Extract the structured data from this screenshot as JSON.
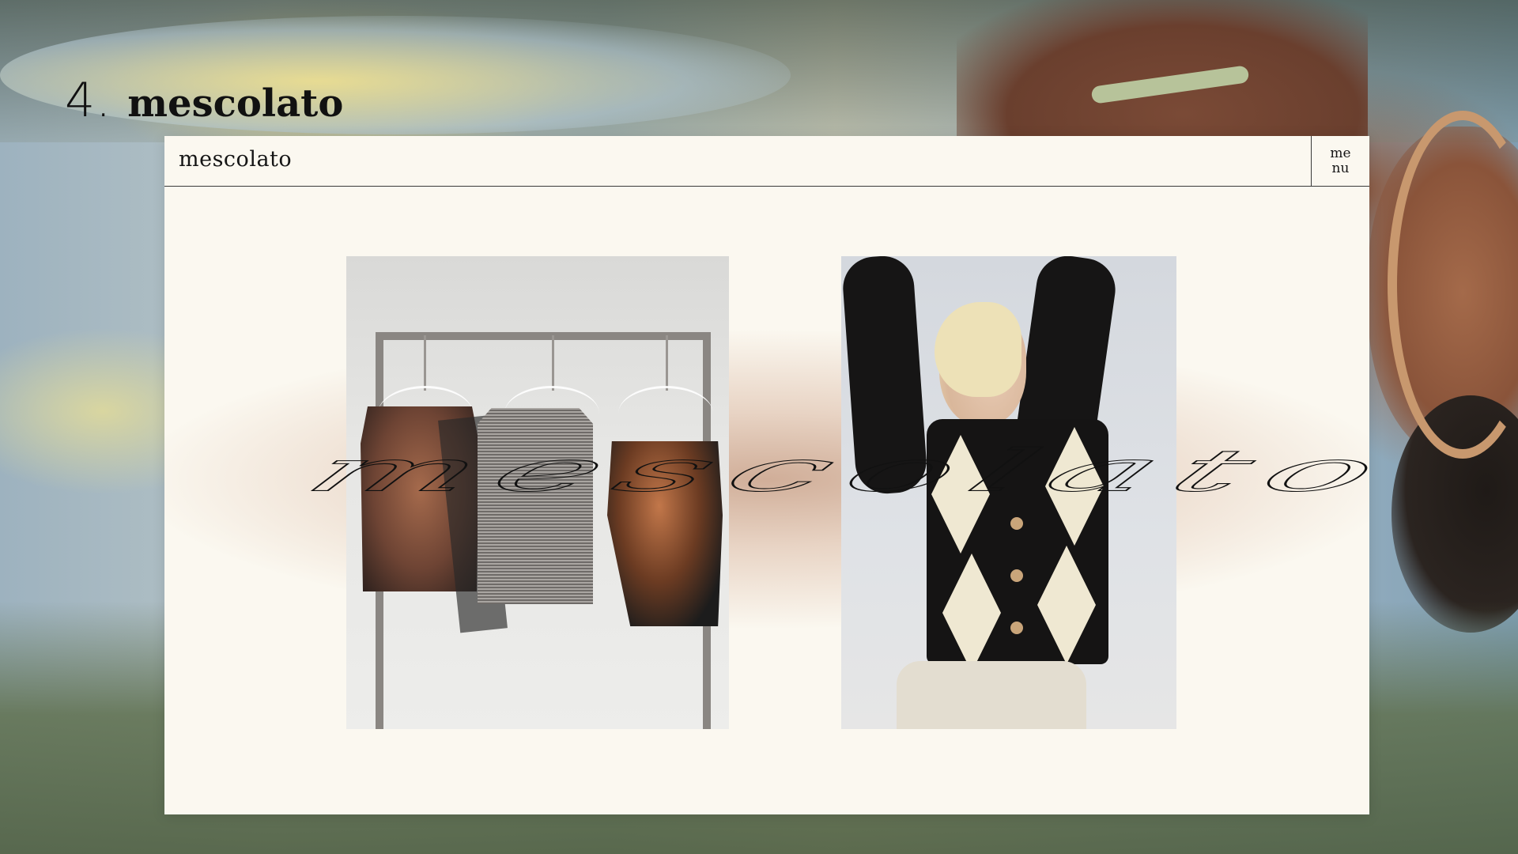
{
  "section": {
    "number": "4.",
    "title": "mescolato"
  },
  "site": {
    "logo": "mescolato",
    "menu_label": "menu",
    "overlay_word": "mescolato"
  },
  "colors": {
    "page_background": "#fbf8f0",
    "glow": "#ceaa94",
    "ink": "#111111"
  },
  "icons": {
    "menu": "text-menu-button"
  }
}
